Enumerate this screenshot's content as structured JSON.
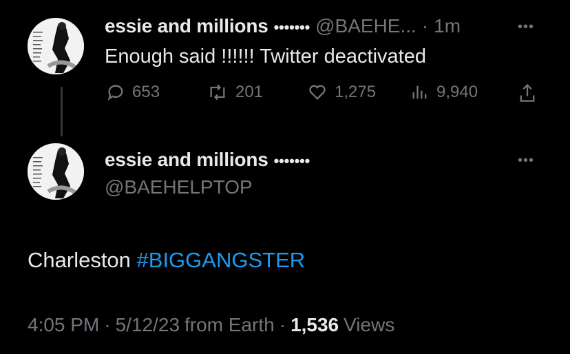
{
  "tweet1": {
    "author_name": "essie and millions",
    "author_badge": "•••••••",
    "handle_truncated": "@BAEHE...",
    "separator": "·",
    "time": "1m",
    "more": "•••",
    "text": "Enough said !!!!!! Twitter deactivated",
    "actions": {
      "replies": "653",
      "retweets": "201",
      "likes": "1,275",
      "views": "9,940"
    }
  },
  "tweet2": {
    "author_name": "essie and millions",
    "author_badge": "•••••••",
    "handle": "@BAEHELPTOP",
    "more": "•••",
    "text_plain": "Charleston ",
    "hashtag": "#BIGGANGSTER",
    "time": "4:05 PM",
    "separator": "·",
    "date": "5/12/23",
    "source": "from Earth",
    "views_count": "1,536",
    "views_label": "Views"
  },
  "icons": [
    "reply-icon",
    "retweet-icon",
    "like-icon",
    "views-icon",
    "share-icon"
  ],
  "colors": {
    "background": "#000000",
    "text": "#e7e9ea",
    "muted": "#71767b",
    "link": "#1d9bf0"
  }
}
